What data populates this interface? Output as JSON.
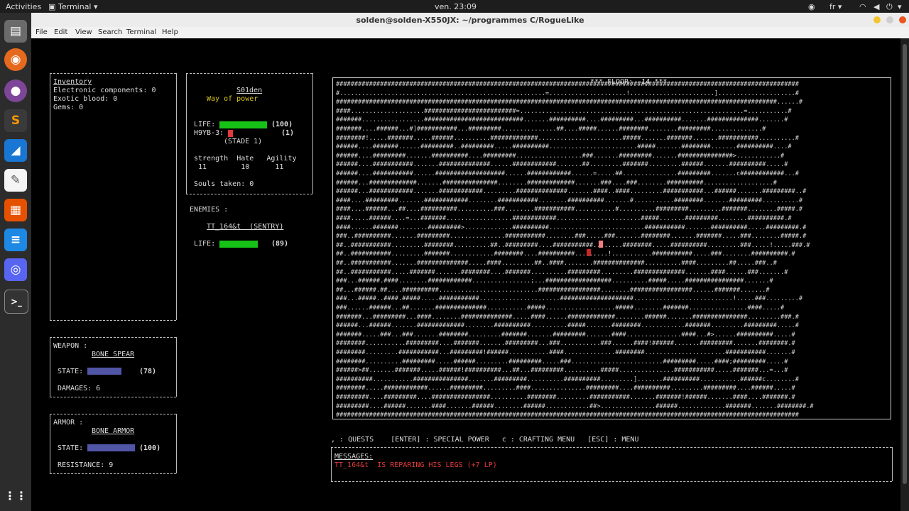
{
  "topbar": {
    "activities": "Activities",
    "app": "Terminal",
    "clock": "ven. 23:09",
    "lang": "fr"
  },
  "dock": {
    "icons": [
      "files-icon",
      "firefox-icon",
      "tor-icon",
      "sublime-icon",
      "browser-icon",
      "text-editor-icon",
      "impress-icon",
      "writer-icon",
      "discord-icon",
      "terminal-icon"
    ]
  },
  "window": {
    "title": "solden@solden-X550JX: ~/programmes C/RogueLike"
  },
  "menu": [
    "File",
    "Edit",
    "View",
    "Search",
    "Terminal",
    "Help"
  ],
  "inventory": {
    "title": "Inventory",
    "items": [
      "Electronic components: 0",
      "Exotic blood: 0",
      "Gems: 0"
    ]
  },
  "player": {
    "name": "S01den",
    "subtitle": "Way of power",
    "life_label": "LIFE:",
    "life_value": "(100)",
    "life_frac": 1.0,
    "h9yb_label": "H9YB-3:",
    "h9yb_value": "(1)",
    "h9yb_frac": 0.1,
    "stage": "(STADE 1)",
    "stat_headers": "strength  Hate   Agility",
    "stat_values": " 11        10      11",
    "souls": "Souls taken: 0"
  },
  "enemies": {
    "label": "ENEMIES :",
    "name": "TT_164&t  (SENTRY)",
    "life_label": "LIFE:",
    "life_value": "(89)",
    "life_frac": 0.89
  },
  "weapon": {
    "label": "WEAPON :",
    "name": "BONE SPEAR",
    "state_label": "STATE:",
    "state_value": "(78)",
    "state_frac": 0.78,
    "damages": "DAMAGES: 6"
  },
  "armor": {
    "label": "ARMOR :",
    "name": "BONE ARMOR",
    "state_label": "STATE:",
    "state_value": "(100)",
    "state_frac": 1.0,
    "resistance": "RESISTANCE: 9"
  },
  "floor": "*** FLOOR: -14 ***",
  "map_rows": [
    "##############################################################################################################################",
    "#........................................................=.....................!.......................].....................#",
    "########################################################################################################################......#",
    "####....................#########################=.............................................................=...........#",
    "#######.................###########################.......##########....#########...##########.......##############.......#",
    "#######....######...#]###########...#########...............##....#####......########........#########..............#",
    "########!.....#######.....######..........#############.......................#####.......#######.......###########..........#",
    "######....#######......#########..#########.....##########........................#####.......########.......##########....#",
    "######....#########.......##########....#########..................###.......#########.......###############>............#",
    "######....###########.......##############......############.......##.........#######.........######.......##########.....#",
    "######....###########......###################......############......=.....##...............#########.......c############...#",
    "######...#############.......###############........#############.......###....###........##########...................#",
    "######...############.......############.........##############.......####..####.........###########...######.......#########..#",
    "####....#########.......############........###########........##########.......#...........########.......#########..........#",
    "####....######...##....##########..........###........###########...........#..........#########.........#######........#####.#",
    "####.....######....=...#######..................############.......................#####.......#########........##########.#",
    "####......#######........#########>.............##########..........................###########.......##########.....#########.#",
    "###..##########.......#########...............###########........###.....###.......########.......#######.....###........#####.#",
    "##..###########.........########..........##..#########....###########........########.....##########.........###.....!.....###.#",
    "##..###########.........#######............########....##########.........!...........###########.....###........##########.#",
    "##..###########.......##############.....####.........##..####........##############..........####.........##.....###..#",
    "##..###########.....#######.......########....#######..........#########.........##############.......####......###.......#",
    "###...######.####........############................;...##################..........#####.....################.......#",
    "##...######.##....##########...........................#################........#################......#######.......#",
    "###...#####..####.#####.....###########......................####################...........................!.....###.........#",
    "###......######...##.......##############...........#####...................#####........#######................####.....#",
    "#######...#########...####........##############.....####......#############........######.......###############.........###.#",
    "######...######.......#############........##########..........#####.......########............#######.........#########.....#",
    "#######.....###...###.......########.........#######.......#########.......####...............####...#>......##########.....#",
    "########...........#########....#######.......#########...###...........###......####!######.......#########.......########.#",
    "########.........###########...#########!######...........####..............########......................###########.......#",
    "########..........#########.....######.........#########.....###.........................#########.....####;#########.....#",
    "######>##.......#######.....######!##########...##...#########..........#####...............###########.....#######...=...#",
    "##########...........###############.......#########..........##########.........].......##########...........######c........#",
    "########.....############......#########.........####...............#########....##########.........#########....######.....#",
    "#########....#########....################..........########.........###########.......#######!######.......####....#######.#",
    "#########....######.......####.......######........######............##>...............######.............#######.......########.#",
    "##############################################################################################################################"
  ],
  "help_line": ", : QUESTS    [ENTER] : SPECIAL POWER   c : CRAFTING MENU   [ESC] : MENU",
  "messages": {
    "label": "MESSAGES:",
    "line": "TT_164&t  IS REPARING HIS LEGS (+7 LP)"
  },
  "colors": {
    "life": "#17c217",
    "state": "#5055a6",
    "danger": "#e23a3a",
    "yellow": "#d8c520"
  }
}
